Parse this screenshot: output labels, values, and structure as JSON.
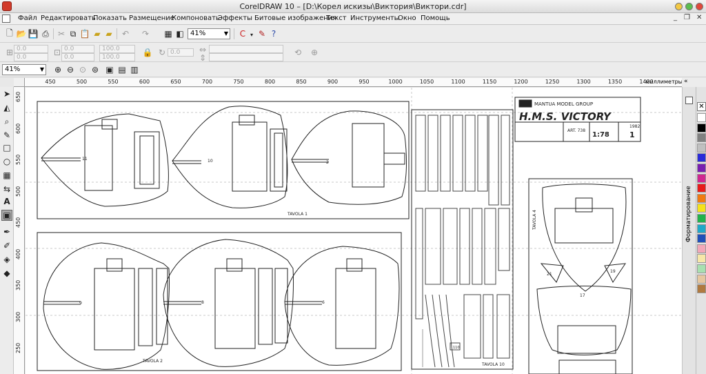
{
  "window": {
    "title": "CorelDRAW 10 – [D:\\Корел искизы\\Виктория\\Виктори.cdr]"
  },
  "menu": {
    "items": [
      "Файл",
      "Редактировать",
      "Показать",
      "Размещение",
      "Компоновать",
      "Эффекты",
      "Битовые изображения",
      "Текст",
      "Инструменты",
      "Окно",
      "Помощь"
    ]
  },
  "toolbar": {
    "zoom_value": "41%",
    "zoom_secondary": "41%"
  },
  "propertybar": {
    "x_value": "0.0",
    "y_value": "0.0",
    "w_value": "0.0",
    "h_value": "0.0",
    "sx_value": "100.0",
    "sy_value": "100.0",
    "angle_value": "0.0"
  },
  "ruler": {
    "units": "миллиметры",
    "h_ticks": [
      "450",
      "500",
      "550",
      "600",
      "650",
      "700",
      "750",
      "800",
      "850",
      "900",
      "950",
      "1000",
      "1050",
      "1100",
      "1150",
      "1200",
      "1250",
      "1300",
      "1350",
      "1400"
    ],
    "v_ticks": [
      "650",
      "600",
      "550",
      "500",
      "450",
      "400",
      "350",
      "300",
      "250"
    ]
  },
  "docker": {
    "tab_label": "Форматирование"
  },
  "drawing": {
    "brand": "MANTUA MODEL GROUP",
    "title": "H.M.S.  VICTORY",
    "art_label": "ART. 738",
    "year": "1982",
    "scale": "1:78",
    "sheet_number": "1",
    "tavola_1": "TAVOLA  1",
    "tavola_2": "TAVOLA  2",
    "tavola_4": "TAVOLA  4",
    "tavola_10": "TAVOLA  10",
    "frame_11": "11",
    "frame_10": "10",
    "frame_2": "2",
    "frame_9": "9",
    "frame_8": "8",
    "frame_6": "6",
    "part_17": "17",
    "part_21": "21",
    "part_19": "19",
    "part_110": "110"
  },
  "palette": {
    "colors": [
      "#ffffff",
      "#000000",
      "#808080",
      "#c0c0c0",
      "#2b2bd8",
      "#7a1fb0",
      "#d02890",
      "#e81c1c",
      "#f07a12",
      "#f5e21b",
      "#22b24c",
      "#1fa8c8",
      "#1f4fb8",
      "#f2a7b8",
      "#f7e7a8",
      "#a8e0b0",
      "#e6c7a0",
      "#b07a40"
    ]
  }
}
